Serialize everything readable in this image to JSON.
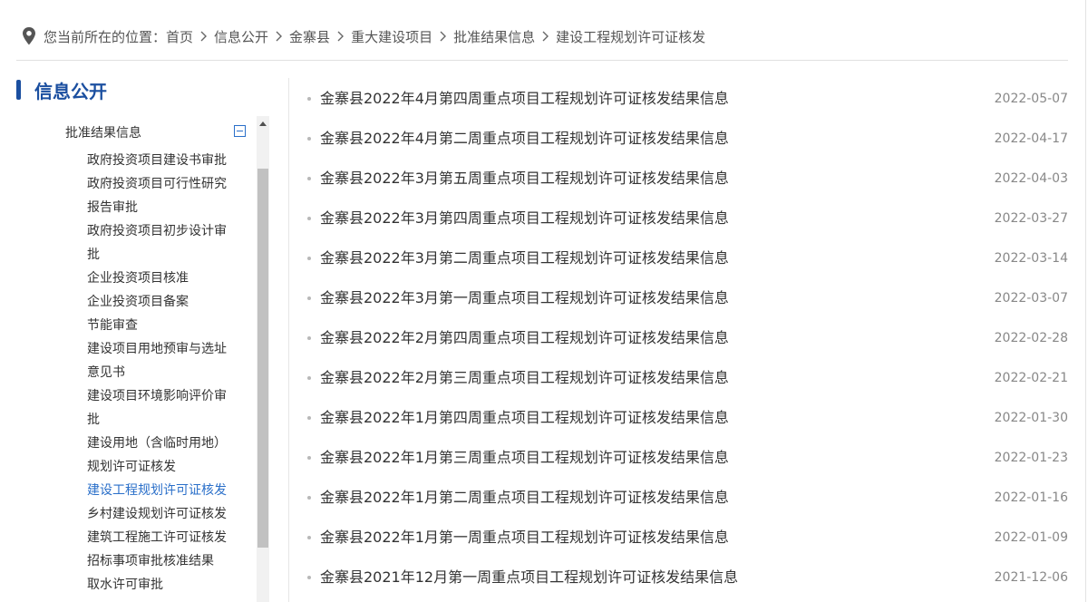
{
  "breadcrumb": {
    "prefix": "您当前所在的位置：",
    "items": [
      "首页",
      "信息公开",
      "金寨县",
      "重大建设项目",
      "批准结果信息",
      "建设工程规划许可证核发"
    ]
  },
  "sidebar": {
    "title": "信息公开",
    "category": "批准结果信息",
    "items": [
      "政府投资项目建设书审批",
      "政府投资项目可行性研究",
      "报告审批",
      "政府投资项目初步设计审",
      "批",
      "企业投资项目核准",
      "企业投资项目备案",
      "节能审查",
      "建设项目用地预审与选址",
      "意见书",
      "建设项目环境影响评价审",
      "批",
      "建设用地（含临时用地）",
      "规划许可证核发",
      "建设工程规划许可证核发",
      "乡村建设规划许可证核发",
      "建筑工程施工许可证核发",
      "招标事项审批核准结果",
      "取水许可审批"
    ],
    "active_index": 14
  },
  "articles": [
    {
      "title": "金寨县2022年4月第四周重点项目工程规划许可证核发结果信息",
      "date": "2022-05-07"
    },
    {
      "title": "金寨县2022年4月第二周重点项目工程规划许可证核发结果信息",
      "date": "2022-04-17"
    },
    {
      "title": "金寨县2022年3月第五周重点项目工程规划许可证核发结果信息",
      "date": "2022-04-03"
    },
    {
      "title": "金寨县2022年3月第四周重点项目工程规划许可证核发结果信息",
      "date": "2022-03-27"
    },
    {
      "title": "金寨县2022年3月第二周重点项目工程规划许可证核发结果信息",
      "date": "2022-03-14"
    },
    {
      "title": "金寨县2022年3月第一周重点项目工程规划许可证核发结果信息",
      "date": "2022-03-07"
    },
    {
      "title": "金寨县2022年2月第四周重点项目工程规划许可证核发结果信息",
      "date": "2022-02-28"
    },
    {
      "title": "金寨县2022年2月第三周重点项目工程规划许可证核发结果信息",
      "date": "2022-02-21"
    },
    {
      "title": "金寨县2022年1月第四周重点项目工程规划许可证核发结果信息",
      "date": "2022-01-30"
    },
    {
      "title": "金寨县2022年1月第三周重点项目工程规划许可证核发结果信息",
      "date": "2022-01-23"
    },
    {
      "title": "金寨县2022年1月第二周重点项目工程规划许可证核发结果信息",
      "date": "2022-01-16"
    },
    {
      "title": "金寨县2022年1月第一周重点项目工程规划许可证核发结果信息",
      "date": "2022-01-09"
    },
    {
      "title": "金寨县2021年12月第一周重点项目工程规划许可证核发结果信息",
      "date": "2021-12-06"
    }
  ],
  "colors": {
    "accent": "#1b4fa0",
    "active_link": "#2a6fc9",
    "date": "#888888"
  },
  "icons": {
    "location": "location-pin-icon",
    "collapse": "collapse-minus-icon"
  }
}
